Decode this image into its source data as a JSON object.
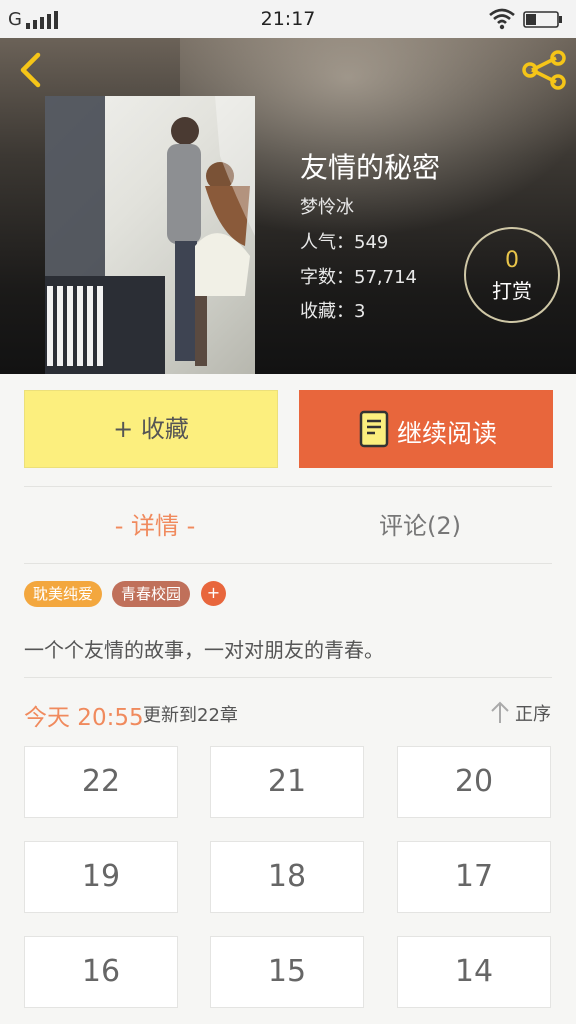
{
  "status_bar": {
    "carrier": "G",
    "time": "21:17",
    "signal_icon": "signal-icon",
    "wifi_icon": "wifi-icon",
    "battery_icon": "battery-icon"
  },
  "header": {
    "back_icon": "chevron-left-icon",
    "share_icon": "share-icon",
    "accent_color": "#f5c518"
  },
  "book": {
    "title": "友情的秘密",
    "author": "梦怜冰",
    "popularity": "人气：549",
    "word_count": "字数：57,714",
    "favorites": "收藏：3"
  },
  "reward": {
    "count": "0",
    "label": "打赏"
  },
  "actions": {
    "favorite_label": "+ 收藏",
    "continue_label": "继续阅读",
    "favorite_color": "#fcef7e",
    "continue_color": "#e8663c"
  },
  "tabs": {
    "detail": "- 详情 -",
    "comments": "评论(2)"
  },
  "tags": [
    "耽美纯爱",
    "青春校园"
  ],
  "tag_add": "+",
  "summary": "一个个友情的故事，一对对朋友的青春。",
  "update": {
    "time": "今天 20:55",
    "text": "更新到22章",
    "sort_label": "正序"
  },
  "chapters": [
    "22",
    "21",
    "20",
    "19",
    "18",
    "17",
    "16",
    "15",
    "14"
  ]
}
